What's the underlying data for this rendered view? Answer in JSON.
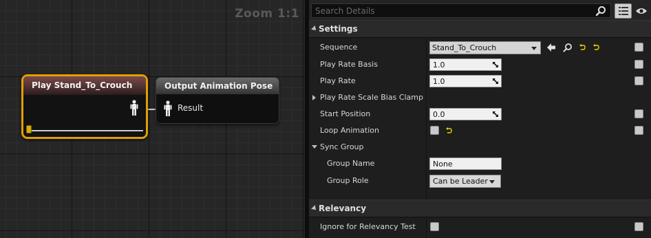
{
  "graph": {
    "zoom_label": "Zoom 1:1",
    "play_node": {
      "title": "Play Stand_To_Crouch",
      "progress": 0.0
    },
    "output_node": {
      "title": "Output Animation Pose",
      "pin_label": "Result"
    }
  },
  "details": {
    "search_placeholder": "Search Details",
    "settings": {
      "label": "Settings",
      "sequence": {
        "label": "Sequence",
        "value": "Stand_To_Crouch"
      },
      "play_rate_basis": {
        "label": "Play Rate Basis",
        "value": "1.0"
      },
      "play_rate": {
        "label": "Play Rate",
        "value": "1.0"
      },
      "scale_bias_clamp": {
        "label": "Play Rate Scale Bias Clamp"
      },
      "start_position": {
        "label": "Start Position",
        "value": "0.0"
      },
      "loop_animation": {
        "label": "Loop Animation",
        "checked": false
      },
      "sync_group": {
        "label": "Sync Group",
        "group_name": {
          "label": "Group Name",
          "value": "None"
        },
        "group_role": {
          "label": "Group Role",
          "value": "Can be Leader"
        }
      }
    },
    "relevancy": {
      "label": "Relevancy",
      "ignore_relevancy": {
        "label": "Ignore for Relevancy Test",
        "checked": false
      }
    }
  },
  "colors": {
    "selection_outline": "#e0a000",
    "play_header": "#7a4a4a",
    "reset_arrow": "#e8d000"
  }
}
